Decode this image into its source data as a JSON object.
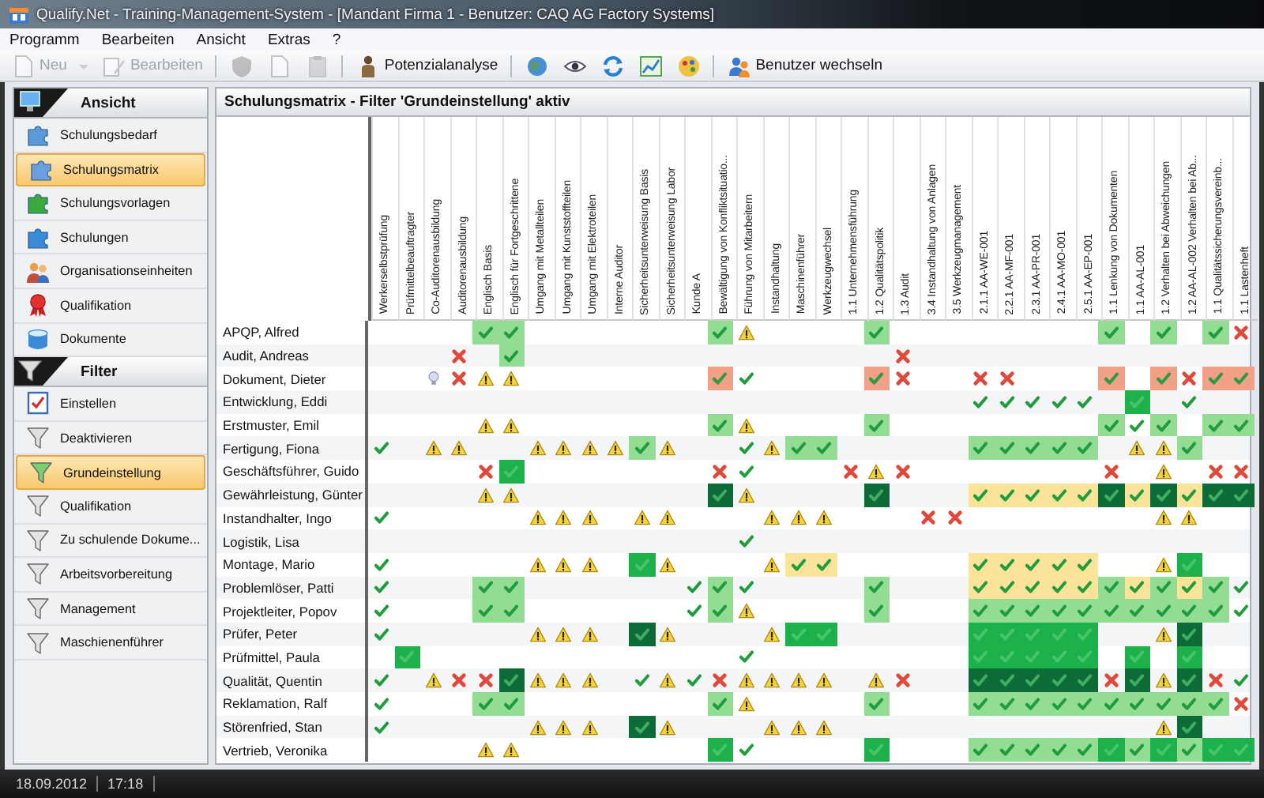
{
  "window": {
    "title": "Qualify.Net - Training-Management-System - [Mandant Firma 1 - Benutzer: CAQ AG Factory Systems]"
  },
  "menu": [
    "Programm",
    "Bearbeiten",
    "Ansicht",
    "Extras",
    "?"
  ],
  "toolbar": [
    {
      "kind": "split",
      "label": "Neu",
      "disabled": true
    },
    {
      "kind": "button",
      "label": "Bearbeiten",
      "disabled": true
    },
    {
      "kind": "separator"
    },
    {
      "kind": "icon",
      "disabled": true
    },
    {
      "kind": "icon",
      "disabled": true
    },
    {
      "kind": "icon",
      "disabled": true
    },
    {
      "kind": "separator"
    },
    {
      "kind": "button",
      "label": "Potenzialanalyse",
      "disabled": false
    },
    {
      "kind": "separator"
    },
    {
      "kind": "icon",
      "disabled": false
    },
    {
      "kind": "icon",
      "disabled": false
    },
    {
      "kind": "icon",
      "disabled": false
    },
    {
      "kind": "icon",
      "disabled": false
    },
    {
      "kind": "icon",
      "disabled": false
    },
    {
      "kind": "separator"
    },
    {
      "kind": "button",
      "label": "Benutzer wechseln",
      "disabled": false
    }
  ],
  "sidebar": {
    "sections": [
      {
        "title": "Ansicht",
        "items": [
          {
            "label": "Schulungsbedarf",
            "selected": false
          },
          {
            "label": "Schulungsmatrix",
            "selected": true
          },
          {
            "label": "Schulungsvorlagen",
            "selected": false
          },
          {
            "label": "Schulungen",
            "selected": false
          },
          {
            "label": "Organisationseinheiten",
            "selected": false
          },
          {
            "label": "Qualifikation",
            "selected": false
          },
          {
            "label": "Dokumente",
            "selected": false
          }
        ]
      },
      {
        "title": "Filter",
        "items": [
          {
            "label": "Einstellen",
            "selected": false
          },
          {
            "label": "Deaktivieren",
            "selected": false
          },
          {
            "label": "Grundeinstellung",
            "selected": true
          },
          {
            "label": "Qualifikation",
            "selected": false
          },
          {
            "label": "Zu schulende Dokume...",
            "selected": false
          },
          {
            "label": "Arbeitsvorbereitung",
            "selected": false
          },
          {
            "label": "Management",
            "selected": false
          },
          {
            "label": "Maschienenführer",
            "selected": false
          }
        ]
      }
    ]
  },
  "matrix": {
    "title": "Schulungsmatrix - Filter 'Grundeinstellung' aktiv",
    "columns": [
      "Werkerselbstprüfung",
      "Prüfmittelbeauftragter",
      "Co-Auditorenausbildung",
      "Auditorenausbildung",
      "Englisch Basis",
      "Englisch für Fortgeschrittene",
      "Umgang mit Metallteilen",
      "Umgang mit Kunststoffteilen",
      "Umgang mit Elektroteilen",
      "Interne Auditor",
      "Sicherheitsunterweisung Basis",
      "Sicherheitsunterweisung Labor",
      "Kunde A",
      "Bewältigung von Konfliktsituatio...",
      "Führung von Mitarbeitern",
      "Instandhaltung",
      "Maschinenführer",
      "Werkzeugwechsel",
      "1.1 Unternehmensführung",
      "1.2 Qualitätspolitik",
      "1.3 Audit",
      "3.4 Instandhaltung von Anlagen",
      "3.5 Werkzeugmanagement",
      "2.1.1 AA-WE-001",
      "2.2.1 AA-MF-001",
      "2.3.1 AA-PR-001",
      "2.4.1 AA-MO-001",
      "2.5.1 AA-EP-001",
      "1.1 Lenkung von Dokumenten",
      "1.1 AA-AL-001",
      "1.2 Verhalten bei Abweichungen",
      "1.2 AA-AL-002 Verhalten bei Ab...",
      "1.1 Qualitätssicherungsvereinb...",
      "1.1 Lastenheft"
    ],
    "rows": [
      {
        "name": "APQP, Alfred",
        "cells": [
          {
            "kind": "none"
          },
          {
            "kind": "none"
          },
          {
            "kind": "none"
          },
          {
            "kind": "none"
          },
          {
            "kind": "light"
          },
          {
            "kind": "light"
          },
          {
            "kind": "none"
          },
          {
            "kind": "none"
          },
          {
            "kind": "none"
          },
          {
            "kind": "none"
          },
          {
            "kind": "none"
          },
          {
            "kind": "none"
          },
          {
            "kind": "none"
          },
          {
            "kind": "light"
          },
          {
            "kind": "warn"
          },
          {
            "kind": "none"
          },
          {
            "kind": "none"
          },
          {
            "kind": "none"
          },
          {
            "kind": "none"
          },
          {
            "kind": "light"
          },
          {
            "kind": "none"
          },
          {
            "kind": "none"
          },
          {
            "kind": "none"
          },
          {
            "kind": "none"
          },
          {
            "kind": "none"
          },
          {
            "kind": "none"
          },
          {
            "kind": "none"
          },
          {
            "kind": "none"
          },
          {
            "kind": "light"
          },
          {
            "kind": "none"
          },
          {
            "kind": "light"
          },
          {
            "kind": "none"
          },
          {
            "kind": "light"
          },
          {
            "kind": "fail"
          }
        ]
      },
      {
        "name": "Audit, Andreas",
        "cells": [
          {
            "kind": "none"
          },
          {
            "kind": "none"
          },
          {
            "kind": "none"
          },
          {
            "kind": "fail"
          },
          {
            "kind": "none"
          },
          {
            "kind": "light"
          },
          {
            "kind": "none"
          },
          {
            "kind": "none"
          },
          {
            "kind": "none"
          },
          {
            "kind": "none"
          },
          {
            "kind": "none"
          },
          {
            "kind": "none"
          },
          {
            "kind": "none"
          },
          {
            "kind": "none"
          },
          {
            "kind": "none"
          },
          {
            "kind": "none"
          },
          {
            "kind": "none"
          },
          {
            "kind": "none"
          },
          {
            "kind": "none"
          },
          {
            "kind": "none"
          },
          {
            "kind": "fail"
          },
          {
            "kind": "none"
          },
          {
            "kind": "none"
          },
          {
            "kind": "none"
          },
          {
            "kind": "none"
          },
          {
            "kind": "none"
          },
          {
            "kind": "none"
          },
          {
            "kind": "none"
          },
          {
            "kind": "none"
          },
          {
            "kind": "none"
          },
          {
            "kind": "none"
          },
          {
            "kind": "none"
          },
          {
            "kind": "none"
          },
          {
            "kind": "none"
          }
        ]
      },
      {
        "name": "Dokument, Dieter",
        "cells": [
          {
            "kind": "none"
          },
          {
            "kind": "none"
          },
          {
            "kind": "idea"
          },
          {
            "kind": "fail"
          },
          {
            "kind": "warn"
          },
          {
            "kind": "warn"
          },
          {
            "kind": "none"
          },
          {
            "kind": "none"
          },
          {
            "kind": "none"
          },
          {
            "kind": "none"
          },
          {
            "kind": "none"
          },
          {
            "kind": "none"
          },
          {
            "kind": "none"
          },
          {
            "kind": "salmon"
          },
          {
            "kind": "ok"
          },
          {
            "kind": "none"
          },
          {
            "kind": "none"
          },
          {
            "kind": "none"
          },
          {
            "kind": "none"
          },
          {
            "kind": "salmon"
          },
          {
            "kind": "fail"
          },
          {
            "kind": "none"
          },
          {
            "kind": "none"
          },
          {
            "kind": "fail"
          },
          {
            "kind": "fail"
          },
          {
            "kind": "none"
          },
          {
            "kind": "none"
          },
          {
            "kind": "none"
          },
          {
            "kind": "salmon"
          },
          {
            "kind": "none"
          },
          {
            "kind": "salmon"
          },
          {
            "kind": "fail"
          },
          {
            "kind": "salmon"
          },
          {
            "kind": "salmon"
          }
        ]
      },
      {
        "name": "Entwicklung, Eddi",
        "cells": [
          {
            "kind": "none"
          },
          {
            "kind": "none"
          },
          {
            "kind": "none"
          },
          {
            "kind": "none"
          },
          {
            "kind": "none"
          },
          {
            "kind": "none"
          },
          {
            "kind": "none"
          },
          {
            "kind": "none"
          },
          {
            "kind": "none"
          },
          {
            "kind": "none"
          },
          {
            "kind": "none"
          },
          {
            "kind": "none"
          },
          {
            "kind": "none"
          },
          {
            "kind": "none"
          },
          {
            "kind": "none"
          },
          {
            "kind": "none"
          },
          {
            "kind": "none"
          },
          {
            "kind": "none"
          },
          {
            "kind": "none"
          },
          {
            "kind": "none"
          },
          {
            "kind": "none"
          },
          {
            "kind": "none"
          },
          {
            "kind": "none"
          },
          {
            "kind": "ok"
          },
          {
            "kind": "ok"
          },
          {
            "kind": "ok"
          },
          {
            "kind": "ok"
          },
          {
            "kind": "ok"
          },
          {
            "kind": "none"
          },
          {
            "kind": "bright"
          },
          {
            "kind": "none"
          },
          {
            "kind": "ok"
          },
          {
            "kind": "none"
          },
          {
            "kind": "none"
          }
        ]
      },
      {
        "name": "Erstmuster, Emil",
        "cells": [
          {
            "kind": "none"
          },
          {
            "kind": "none"
          },
          {
            "kind": "none"
          },
          {
            "kind": "none"
          },
          {
            "kind": "warn"
          },
          {
            "kind": "warn"
          },
          {
            "kind": "none"
          },
          {
            "kind": "none"
          },
          {
            "kind": "none"
          },
          {
            "kind": "none"
          },
          {
            "kind": "none"
          },
          {
            "kind": "none"
          },
          {
            "kind": "none"
          },
          {
            "kind": "light"
          },
          {
            "kind": "warn"
          },
          {
            "kind": "none"
          },
          {
            "kind": "none"
          },
          {
            "kind": "none"
          },
          {
            "kind": "none"
          },
          {
            "kind": "light"
          },
          {
            "kind": "none"
          },
          {
            "kind": "none"
          },
          {
            "kind": "none"
          },
          {
            "kind": "none"
          },
          {
            "kind": "none"
          },
          {
            "kind": "none"
          },
          {
            "kind": "none"
          },
          {
            "kind": "none"
          },
          {
            "kind": "light"
          },
          {
            "kind": "ok"
          },
          {
            "kind": "light"
          },
          {
            "kind": "none"
          },
          {
            "kind": "light"
          },
          {
            "kind": "light"
          }
        ]
      },
      {
        "name": "Fertigung, Fiona",
        "cells": [
          {
            "kind": "ok"
          },
          {
            "kind": "none"
          },
          {
            "kind": "warn"
          },
          {
            "kind": "warn"
          },
          {
            "kind": "none"
          },
          {
            "kind": "none"
          },
          {
            "kind": "warn"
          },
          {
            "kind": "warn"
          },
          {
            "kind": "warn"
          },
          {
            "kind": "warn"
          },
          {
            "kind": "light"
          },
          {
            "kind": "warn"
          },
          {
            "kind": "none"
          },
          {
            "kind": "none"
          },
          {
            "kind": "ok"
          },
          {
            "kind": "warn"
          },
          {
            "kind": "light"
          },
          {
            "kind": "light"
          },
          {
            "kind": "none"
          },
          {
            "kind": "none"
          },
          {
            "kind": "none"
          },
          {
            "kind": "none"
          },
          {
            "kind": "none"
          },
          {
            "kind": "light"
          },
          {
            "kind": "light"
          },
          {
            "kind": "light"
          },
          {
            "kind": "light"
          },
          {
            "kind": "light"
          },
          {
            "kind": "none"
          },
          {
            "kind": "warn"
          },
          {
            "kind": "warn"
          },
          {
            "kind": "light"
          },
          {
            "kind": "none"
          },
          {
            "kind": "none"
          }
        ]
      },
      {
        "name": "Geschäftsführer, Guido",
        "cells": [
          {
            "kind": "none"
          },
          {
            "kind": "none"
          },
          {
            "kind": "none"
          },
          {
            "kind": "none"
          },
          {
            "kind": "fail"
          },
          {
            "kind": "bright"
          },
          {
            "kind": "none"
          },
          {
            "kind": "none"
          },
          {
            "kind": "none"
          },
          {
            "kind": "none"
          },
          {
            "kind": "none"
          },
          {
            "kind": "none"
          },
          {
            "kind": "none"
          },
          {
            "kind": "fail"
          },
          {
            "kind": "ok"
          },
          {
            "kind": "none"
          },
          {
            "kind": "none"
          },
          {
            "kind": "none"
          },
          {
            "kind": "fail"
          },
          {
            "kind": "warn"
          },
          {
            "kind": "fail"
          },
          {
            "kind": "none"
          },
          {
            "kind": "none"
          },
          {
            "kind": "none"
          },
          {
            "kind": "none"
          },
          {
            "kind": "none"
          },
          {
            "kind": "none"
          },
          {
            "kind": "none"
          },
          {
            "kind": "fail"
          },
          {
            "kind": "none"
          },
          {
            "kind": "warn"
          },
          {
            "kind": "none"
          },
          {
            "kind": "fail"
          },
          {
            "kind": "fail"
          }
        ]
      },
      {
        "name": "Gewährleistung, Günter",
        "cells": [
          {
            "kind": "none"
          },
          {
            "kind": "none"
          },
          {
            "kind": "none"
          },
          {
            "kind": "none"
          },
          {
            "kind": "warn"
          },
          {
            "kind": "warn"
          },
          {
            "kind": "none"
          },
          {
            "kind": "none"
          },
          {
            "kind": "none"
          },
          {
            "kind": "none"
          },
          {
            "kind": "none"
          },
          {
            "kind": "none"
          },
          {
            "kind": "none"
          },
          {
            "kind": "dark"
          },
          {
            "kind": "warn"
          },
          {
            "kind": "none"
          },
          {
            "kind": "none"
          },
          {
            "kind": "none"
          },
          {
            "kind": "none"
          },
          {
            "kind": "dark"
          },
          {
            "kind": "none"
          },
          {
            "kind": "none"
          },
          {
            "kind": "none"
          },
          {
            "kind": "yellow"
          },
          {
            "kind": "yellow"
          },
          {
            "kind": "yellow"
          },
          {
            "kind": "yellow"
          },
          {
            "kind": "yellow"
          },
          {
            "kind": "dark"
          },
          {
            "kind": "yellow"
          },
          {
            "kind": "dark"
          },
          {
            "kind": "yellow"
          },
          {
            "kind": "dark"
          },
          {
            "kind": "dark"
          }
        ]
      },
      {
        "name": "Instandhalter, Ingo",
        "cells": [
          {
            "kind": "ok"
          },
          {
            "kind": "none"
          },
          {
            "kind": "none"
          },
          {
            "kind": "none"
          },
          {
            "kind": "none"
          },
          {
            "kind": "none"
          },
          {
            "kind": "warn"
          },
          {
            "kind": "warn"
          },
          {
            "kind": "warn"
          },
          {
            "kind": "none"
          },
          {
            "kind": "warn"
          },
          {
            "kind": "warn"
          },
          {
            "kind": "none"
          },
          {
            "kind": "none"
          },
          {
            "kind": "none"
          },
          {
            "kind": "warn"
          },
          {
            "kind": "warn"
          },
          {
            "kind": "warn"
          },
          {
            "kind": "none"
          },
          {
            "kind": "none"
          },
          {
            "kind": "none"
          },
          {
            "kind": "fail"
          },
          {
            "kind": "fail"
          },
          {
            "kind": "none"
          },
          {
            "kind": "none"
          },
          {
            "kind": "none"
          },
          {
            "kind": "none"
          },
          {
            "kind": "none"
          },
          {
            "kind": "none"
          },
          {
            "kind": "none"
          },
          {
            "kind": "warn"
          },
          {
            "kind": "warn"
          },
          {
            "kind": "none"
          },
          {
            "kind": "none"
          }
        ]
      },
      {
        "name": "Logistik, Lisa",
        "cells": [
          {
            "kind": "none"
          },
          {
            "kind": "none"
          },
          {
            "kind": "none"
          },
          {
            "kind": "none"
          },
          {
            "kind": "none"
          },
          {
            "kind": "none"
          },
          {
            "kind": "none"
          },
          {
            "kind": "none"
          },
          {
            "kind": "none"
          },
          {
            "kind": "none"
          },
          {
            "kind": "none"
          },
          {
            "kind": "none"
          },
          {
            "kind": "none"
          },
          {
            "kind": "none"
          },
          {
            "kind": "ok"
          },
          {
            "kind": "none"
          },
          {
            "kind": "none"
          },
          {
            "kind": "none"
          },
          {
            "kind": "none"
          },
          {
            "kind": "none"
          },
          {
            "kind": "none"
          },
          {
            "kind": "none"
          },
          {
            "kind": "none"
          },
          {
            "kind": "none"
          },
          {
            "kind": "none"
          },
          {
            "kind": "none"
          },
          {
            "kind": "none"
          },
          {
            "kind": "none"
          },
          {
            "kind": "none"
          },
          {
            "kind": "none"
          },
          {
            "kind": "none"
          },
          {
            "kind": "none"
          },
          {
            "kind": "none"
          },
          {
            "kind": "none"
          }
        ]
      },
      {
        "name": "Montage, Mario",
        "cells": [
          {
            "kind": "ok"
          },
          {
            "kind": "none"
          },
          {
            "kind": "none"
          },
          {
            "kind": "none"
          },
          {
            "kind": "none"
          },
          {
            "kind": "none"
          },
          {
            "kind": "warn"
          },
          {
            "kind": "warn"
          },
          {
            "kind": "warn"
          },
          {
            "kind": "none"
          },
          {
            "kind": "bright"
          },
          {
            "kind": "warn"
          },
          {
            "kind": "none"
          },
          {
            "kind": "none"
          },
          {
            "kind": "none"
          },
          {
            "kind": "warn"
          },
          {
            "kind": "yellow"
          },
          {
            "kind": "yellow"
          },
          {
            "kind": "none"
          },
          {
            "kind": "none"
          },
          {
            "kind": "none"
          },
          {
            "kind": "none"
          },
          {
            "kind": "none"
          },
          {
            "kind": "yellow"
          },
          {
            "kind": "yellow"
          },
          {
            "kind": "yellow"
          },
          {
            "kind": "yellow"
          },
          {
            "kind": "yellow"
          },
          {
            "kind": "none"
          },
          {
            "kind": "none"
          },
          {
            "kind": "warn"
          },
          {
            "kind": "bright"
          },
          {
            "kind": "none"
          },
          {
            "kind": "none"
          }
        ]
      },
      {
        "name": "Problemlöser, Patti",
        "cells": [
          {
            "kind": "ok"
          },
          {
            "kind": "none"
          },
          {
            "kind": "none"
          },
          {
            "kind": "none"
          },
          {
            "kind": "light"
          },
          {
            "kind": "light"
          },
          {
            "kind": "none"
          },
          {
            "kind": "none"
          },
          {
            "kind": "none"
          },
          {
            "kind": "none"
          },
          {
            "kind": "none"
          },
          {
            "kind": "none"
          },
          {
            "kind": "ok"
          },
          {
            "kind": "light"
          },
          {
            "kind": "ok"
          },
          {
            "kind": "none"
          },
          {
            "kind": "none"
          },
          {
            "kind": "none"
          },
          {
            "kind": "none"
          },
          {
            "kind": "light"
          },
          {
            "kind": "none"
          },
          {
            "kind": "none"
          },
          {
            "kind": "none"
          },
          {
            "kind": "yellow"
          },
          {
            "kind": "yellow"
          },
          {
            "kind": "yellow"
          },
          {
            "kind": "yellow"
          },
          {
            "kind": "yellow"
          },
          {
            "kind": "light"
          },
          {
            "kind": "yellow"
          },
          {
            "kind": "light"
          },
          {
            "kind": "yellow"
          },
          {
            "kind": "light"
          },
          {
            "kind": "ok"
          }
        ]
      },
      {
        "name": "Projektleiter, Popov",
        "cells": [
          {
            "kind": "ok"
          },
          {
            "kind": "none"
          },
          {
            "kind": "none"
          },
          {
            "kind": "none"
          },
          {
            "kind": "light"
          },
          {
            "kind": "light"
          },
          {
            "kind": "none"
          },
          {
            "kind": "none"
          },
          {
            "kind": "none"
          },
          {
            "kind": "none"
          },
          {
            "kind": "none"
          },
          {
            "kind": "none"
          },
          {
            "kind": "ok"
          },
          {
            "kind": "light"
          },
          {
            "kind": "warn"
          },
          {
            "kind": "none"
          },
          {
            "kind": "none"
          },
          {
            "kind": "none"
          },
          {
            "kind": "none"
          },
          {
            "kind": "light"
          },
          {
            "kind": "none"
          },
          {
            "kind": "none"
          },
          {
            "kind": "none"
          },
          {
            "kind": "light"
          },
          {
            "kind": "light"
          },
          {
            "kind": "light"
          },
          {
            "kind": "light"
          },
          {
            "kind": "light"
          },
          {
            "kind": "light"
          },
          {
            "kind": "light"
          },
          {
            "kind": "light"
          },
          {
            "kind": "light"
          },
          {
            "kind": "light"
          },
          {
            "kind": "ok"
          }
        ]
      },
      {
        "name": "Prüfer, Peter",
        "cells": [
          {
            "kind": "ok"
          },
          {
            "kind": "none"
          },
          {
            "kind": "none"
          },
          {
            "kind": "none"
          },
          {
            "kind": "none"
          },
          {
            "kind": "none"
          },
          {
            "kind": "warn"
          },
          {
            "kind": "warn"
          },
          {
            "kind": "warn"
          },
          {
            "kind": "none"
          },
          {
            "kind": "dark"
          },
          {
            "kind": "warn"
          },
          {
            "kind": "none"
          },
          {
            "kind": "none"
          },
          {
            "kind": "none"
          },
          {
            "kind": "warn"
          },
          {
            "kind": "bright"
          },
          {
            "kind": "bright"
          },
          {
            "kind": "none"
          },
          {
            "kind": "none"
          },
          {
            "kind": "none"
          },
          {
            "kind": "none"
          },
          {
            "kind": "none"
          },
          {
            "kind": "bright"
          },
          {
            "kind": "bright"
          },
          {
            "kind": "bright"
          },
          {
            "kind": "bright"
          },
          {
            "kind": "bright"
          },
          {
            "kind": "none"
          },
          {
            "kind": "none"
          },
          {
            "kind": "warn"
          },
          {
            "kind": "dark"
          },
          {
            "kind": "none"
          },
          {
            "kind": "none"
          }
        ]
      },
      {
        "name": "Prüfmittel, Paula",
        "cells": [
          {
            "kind": "none"
          },
          {
            "kind": "bright"
          },
          {
            "kind": "none"
          },
          {
            "kind": "none"
          },
          {
            "kind": "none"
          },
          {
            "kind": "none"
          },
          {
            "kind": "none"
          },
          {
            "kind": "none"
          },
          {
            "kind": "none"
          },
          {
            "kind": "none"
          },
          {
            "kind": "none"
          },
          {
            "kind": "none"
          },
          {
            "kind": "none"
          },
          {
            "kind": "none"
          },
          {
            "kind": "ok"
          },
          {
            "kind": "none"
          },
          {
            "kind": "none"
          },
          {
            "kind": "none"
          },
          {
            "kind": "none"
          },
          {
            "kind": "none"
          },
          {
            "kind": "none"
          },
          {
            "kind": "none"
          },
          {
            "kind": "none"
          },
          {
            "kind": "bright"
          },
          {
            "kind": "bright"
          },
          {
            "kind": "bright"
          },
          {
            "kind": "bright"
          },
          {
            "kind": "bright"
          },
          {
            "kind": "none"
          },
          {
            "kind": "bright"
          },
          {
            "kind": "none"
          },
          {
            "kind": "bright"
          },
          {
            "kind": "none"
          },
          {
            "kind": "none"
          }
        ]
      },
      {
        "name": "Qualität, Quentin",
        "cells": [
          {
            "kind": "ok"
          },
          {
            "kind": "none"
          },
          {
            "kind": "warn"
          },
          {
            "kind": "fail"
          },
          {
            "kind": "fail"
          },
          {
            "kind": "dark"
          },
          {
            "kind": "warn"
          },
          {
            "kind": "warn"
          },
          {
            "kind": "warn"
          },
          {
            "kind": "none"
          },
          {
            "kind": "ok"
          },
          {
            "kind": "warn"
          },
          {
            "kind": "ok"
          },
          {
            "kind": "fail"
          },
          {
            "kind": "warn"
          },
          {
            "kind": "warn"
          },
          {
            "kind": "warn"
          },
          {
            "kind": "warn"
          },
          {
            "kind": "none"
          },
          {
            "kind": "warn"
          },
          {
            "kind": "fail"
          },
          {
            "kind": "none"
          },
          {
            "kind": "none"
          },
          {
            "kind": "dark"
          },
          {
            "kind": "dark"
          },
          {
            "kind": "dark"
          },
          {
            "kind": "dark"
          },
          {
            "kind": "dark"
          },
          {
            "kind": "fail"
          },
          {
            "kind": "dark"
          },
          {
            "kind": "warn"
          },
          {
            "kind": "dark"
          },
          {
            "kind": "fail"
          },
          {
            "kind": "ok"
          }
        ]
      },
      {
        "name": "Reklamation, Ralf",
        "cells": [
          {
            "kind": "ok"
          },
          {
            "kind": "none"
          },
          {
            "kind": "none"
          },
          {
            "kind": "none"
          },
          {
            "kind": "light"
          },
          {
            "kind": "light"
          },
          {
            "kind": "none"
          },
          {
            "kind": "none"
          },
          {
            "kind": "none"
          },
          {
            "kind": "none"
          },
          {
            "kind": "none"
          },
          {
            "kind": "none"
          },
          {
            "kind": "none"
          },
          {
            "kind": "light"
          },
          {
            "kind": "warn"
          },
          {
            "kind": "none"
          },
          {
            "kind": "none"
          },
          {
            "kind": "none"
          },
          {
            "kind": "none"
          },
          {
            "kind": "light"
          },
          {
            "kind": "none"
          },
          {
            "kind": "none"
          },
          {
            "kind": "none"
          },
          {
            "kind": "light"
          },
          {
            "kind": "light"
          },
          {
            "kind": "light"
          },
          {
            "kind": "light"
          },
          {
            "kind": "light"
          },
          {
            "kind": "light"
          },
          {
            "kind": "light"
          },
          {
            "kind": "light"
          },
          {
            "kind": "light"
          },
          {
            "kind": "light"
          },
          {
            "kind": "fail"
          }
        ]
      },
      {
        "name": "Störenfried, Stan",
        "cells": [
          {
            "kind": "ok"
          },
          {
            "kind": "none"
          },
          {
            "kind": "none"
          },
          {
            "kind": "none"
          },
          {
            "kind": "none"
          },
          {
            "kind": "none"
          },
          {
            "kind": "warn"
          },
          {
            "kind": "warn"
          },
          {
            "kind": "warn"
          },
          {
            "kind": "none"
          },
          {
            "kind": "dark"
          },
          {
            "kind": "warn"
          },
          {
            "kind": "none"
          },
          {
            "kind": "none"
          },
          {
            "kind": "none"
          },
          {
            "kind": "warn"
          },
          {
            "kind": "warn"
          },
          {
            "kind": "warn"
          },
          {
            "kind": "none"
          },
          {
            "kind": "none"
          },
          {
            "kind": "none"
          },
          {
            "kind": "none"
          },
          {
            "kind": "none"
          },
          {
            "kind": "none"
          },
          {
            "kind": "none"
          },
          {
            "kind": "none"
          },
          {
            "kind": "none"
          },
          {
            "kind": "none"
          },
          {
            "kind": "none"
          },
          {
            "kind": "none"
          },
          {
            "kind": "warn"
          },
          {
            "kind": "dark"
          },
          {
            "kind": "none"
          },
          {
            "kind": "none"
          }
        ]
      },
      {
        "name": "Vertrieb, Veronika",
        "cells": [
          {
            "kind": "none"
          },
          {
            "kind": "none"
          },
          {
            "kind": "none"
          },
          {
            "kind": "none"
          },
          {
            "kind": "warn"
          },
          {
            "kind": "warn"
          },
          {
            "kind": "none"
          },
          {
            "kind": "none"
          },
          {
            "kind": "none"
          },
          {
            "kind": "none"
          },
          {
            "kind": "none"
          },
          {
            "kind": "none"
          },
          {
            "kind": "none"
          },
          {
            "kind": "bright"
          },
          {
            "kind": "ok"
          },
          {
            "kind": "none"
          },
          {
            "kind": "none"
          },
          {
            "kind": "none"
          },
          {
            "kind": "none"
          },
          {
            "kind": "bright"
          },
          {
            "kind": "none"
          },
          {
            "kind": "none"
          },
          {
            "kind": "none"
          },
          {
            "kind": "light"
          },
          {
            "kind": "light"
          },
          {
            "kind": "light"
          },
          {
            "kind": "light"
          },
          {
            "kind": "light"
          },
          {
            "kind": "bright"
          },
          {
            "kind": "light"
          },
          {
            "kind": "bright"
          },
          {
            "kind": "light"
          },
          {
            "kind": "bright"
          },
          {
            "kind": "bright"
          }
        ]
      }
    ]
  },
  "status_bar": {
    "date": "18.09.2012",
    "time": "17:18"
  }
}
